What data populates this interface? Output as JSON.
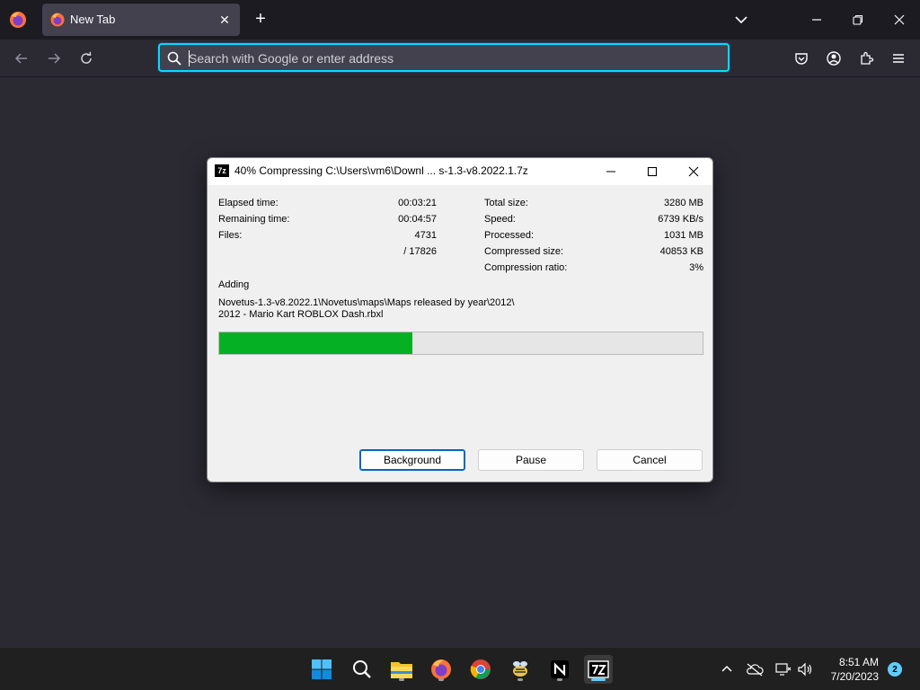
{
  "browser": {
    "tab_title": "New Tab",
    "new_tab_symbol": "+",
    "close_tab_symbol": "✕",
    "url_placeholder": "Search with Google or enter address",
    "accent_color": "#00ddff"
  },
  "dialog": {
    "title": "40% Compressing C:\\Users\\vm6\\Downl ... s-1.3-v8.2022.1.7z",
    "icon_label": "7z",
    "stats_left": [
      {
        "label": "Elapsed time:",
        "value": "00:03:21"
      },
      {
        "label": "Remaining time:",
        "value": "00:04:57"
      },
      {
        "label": "Files:",
        "value": "4731"
      },
      {
        "label": "",
        "value": "/ 17826"
      }
    ],
    "stats_right": [
      {
        "label": "Total size:",
        "value": "3280 MB"
      },
      {
        "label": "Speed:",
        "value": "6739 KB/s"
      },
      {
        "label": "Processed:",
        "value": "1031 MB"
      },
      {
        "label": "Compressed size:",
        "value": "40853 KB"
      },
      {
        "label": "Compression ratio:",
        "value": "3%"
      }
    ],
    "operation": "Adding",
    "current_file_line1": "Novetus-1.3-v8.2022.1\\Novetus\\maps\\Maps released by year\\2012\\",
    "current_file_line2": "2012 - Mario Kart ROBLOX Dash.rbxl",
    "progress_percent": 40,
    "progress_color": "#06b025",
    "buttons": {
      "background": "Background",
      "pause": "Pause",
      "cancel": "Cancel"
    }
  },
  "taskbar": {
    "time": "8:51 AM",
    "date": "7/20/2023",
    "notification_count": "2",
    "apps": [
      "start-icon",
      "search-icon",
      "file-explorer-icon",
      "firefox-icon",
      "chrome-icon",
      "bee-app-icon",
      "notion-icon",
      "7zip-icon"
    ]
  }
}
